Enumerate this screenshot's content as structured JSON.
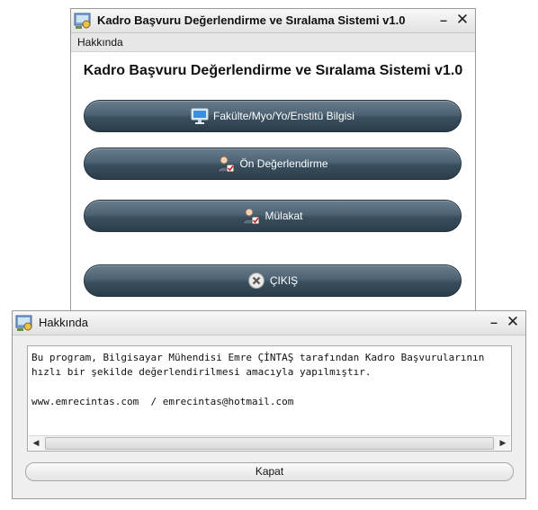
{
  "main_window": {
    "title": "Kadro Başvuru Değerlendirme ve Sıralama Sistemi v1.0",
    "min_glyph": "–",
    "close_glyph": "✕",
    "menu": [
      "Hakkında"
    ],
    "heading": "Kadro Başvuru Değerlendirme ve Sıralama Sistemi v1.0",
    "buttons": [
      {
        "label": "Fakülte/Myo/Yo/Enstitü Bilgisi",
        "icon": "monitor-icon"
      },
      {
        "label": "Ön Değerlendirme",
        "icon": "user-check-icon"
      },
      {
        "label": "Mülakat",
        "icon": "user-check-icon"
      },
      {
        "label": "ÇIKIŞ",
        "icon": "close-circle-icon"
      }
    ]
  },
  "about_window": {
    "title": "Hakkında",
    "min_glyph": "–",
    "close_glyph": "✕",
    "text_lines": [
      "Bu program, Bilgisayar Mühendisi Emre ÇİNTAŞ tarafından Kadro Başvurularının",
      "hızlı bir şekilde değerlendirilmesi amacıyla yapılmıştır.",
      "",
      "www.emrecintas.com  / emrecintas@hotmail.com"
    ],
    "scroll_left_glyph": "◀",
    "scroll_right_glyph": "▶",
    "close_button_label": "Kapat"
  },
  "colors": {
    "button_dark": "#3a4f5f",
    "button_light": "#687c8c",
    "window_bg": "#efefef"
  }
}
